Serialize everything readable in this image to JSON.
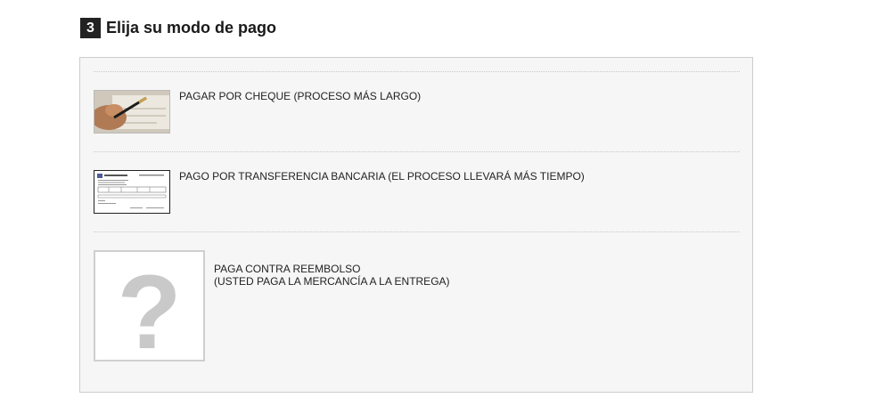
{
  "step": {
    "number": "3",
    "title": "Elija su modo de pago"
  },
  "payment_options": [
    {
      "label": "PAGAR POR CHEQUE (PROCESO MÁS LARGO)",
      "icon": "cheque-photo-icon"
    },
    {
      "label": "PAGO POR TRANSFERENCIA BANCARIA (EL PROCESO LLEVARÁ MÁS TIEMPO)",
      "icon": "bank-transfer-form-icon"
    },
    {
      "label_line1": "PAGA CONTRA REEMBOLSO",
      "label_line2": "(USTED PAGA LA MERCANCÍA A LA ENTREGA)",
      "icon": "question-mark-icon",
      "placeholder_glyph": "?"
    }
  ]
}
